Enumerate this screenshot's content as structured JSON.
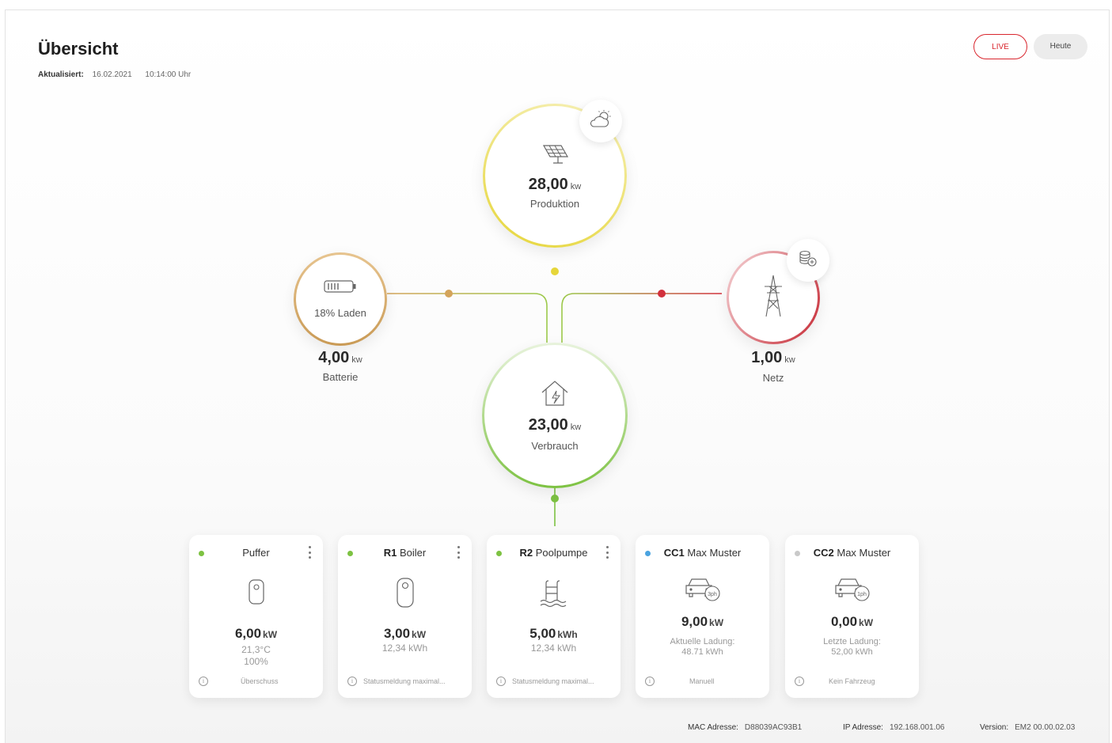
{
  "header": {
    "title": "Übersicht",
    "updated_label": "Aktualisiert:",
    "updated_date": "16.02.2021",
    "updated_time": "10:14:00 Uhr"
  },
  "mode_buttons": {
    "live": "LIVE",
    "heute": "Heute"
  },
  "nodes": {
    "produktion": {
      "value": "28,00",
      "unit": "kw",
      "label": "Produktion",
      "color": "#e6d63a"
    },
    "batterie": {
      "status": "18% Laden",
      "value": "4,00",
      "unit": "kw",
      "label": "Batterie",
      "color": "#d4a45a"
    },
    "netz": {
      "value": "1,00",
      "unit": "kw",
      "label": "Netz",
      "color": "#d2303c"
    },
    "verbrauch": {
      "value": "23,00",
      "unit": "kw",
      "label": "Verbrauch",
      "color": "#7dc242"
    }
  },
  "cards": [
    {
      "title_bold": "",
      "title": "Puffer",
      "status_color": "#7dc242",
      "value": "6,00",
      "unit": "kW",
      "line1": "21,3°C",
      "line2": "100%",
      "footer": "Überschuss",
      "icon": "tank-icon"
    },
    {
      "title_bold": "R1",
      "title": "Boiler",
      "status_color": "#7dc242",
      "value": "3,00",
      "unit": "kW",
      "line1": "12,34 kWh",
      "line2": "",
      "footer": "Statusmeldung maximal...",
      "icon": "boiler-icon"
    },
    {
      "title_bold": "R2",
      "title": "Poolpumpe",
      "status_color": "#7dc242",
      "value": "5,00",
      "unit": "kWh",
      "line1": "12,34 kWh",
      "line2": "",
      "footer": "Statusmeldung maximal...",
      "icon": "pool-icon"
    },
    {
      "title_bold": "CC1",
      "title": "Max Muster",
      "status_color": "#4aa3e0",
      "value": "9,00",
      "unit": "kW",
      "line1": "Aktuelle Ladung:",
      "line2": "48.71 kWh",
      "footer": "Manuell",
      "icon": "car-3ph-icon",
      "badge": "3ph"
    },
    {
      "title_bold": "CC2",
      "title": "Max Muster",
      "status_color": "#c9c9c9",
      "value": "0,00",
      "unit": "kW",
      "line1": "Letzte Ladung:",
      "line2": "52,00 kWh",
      "footer": "Kein Fahrzeug",
      "icon": "car-1ph-icon",
      "badge": "1ph"
    }
  ],
  "footer": {
    "mac_label": "MAC Adresse:",
    "mac_value": "D88039AC93B1",
    "ip_label": "IP Adresse:",
    "ip_value": "192.168.001.06",
    "version_label": "Version:",
    "version_value": "EM2 00.00.02.03"
  }
}
